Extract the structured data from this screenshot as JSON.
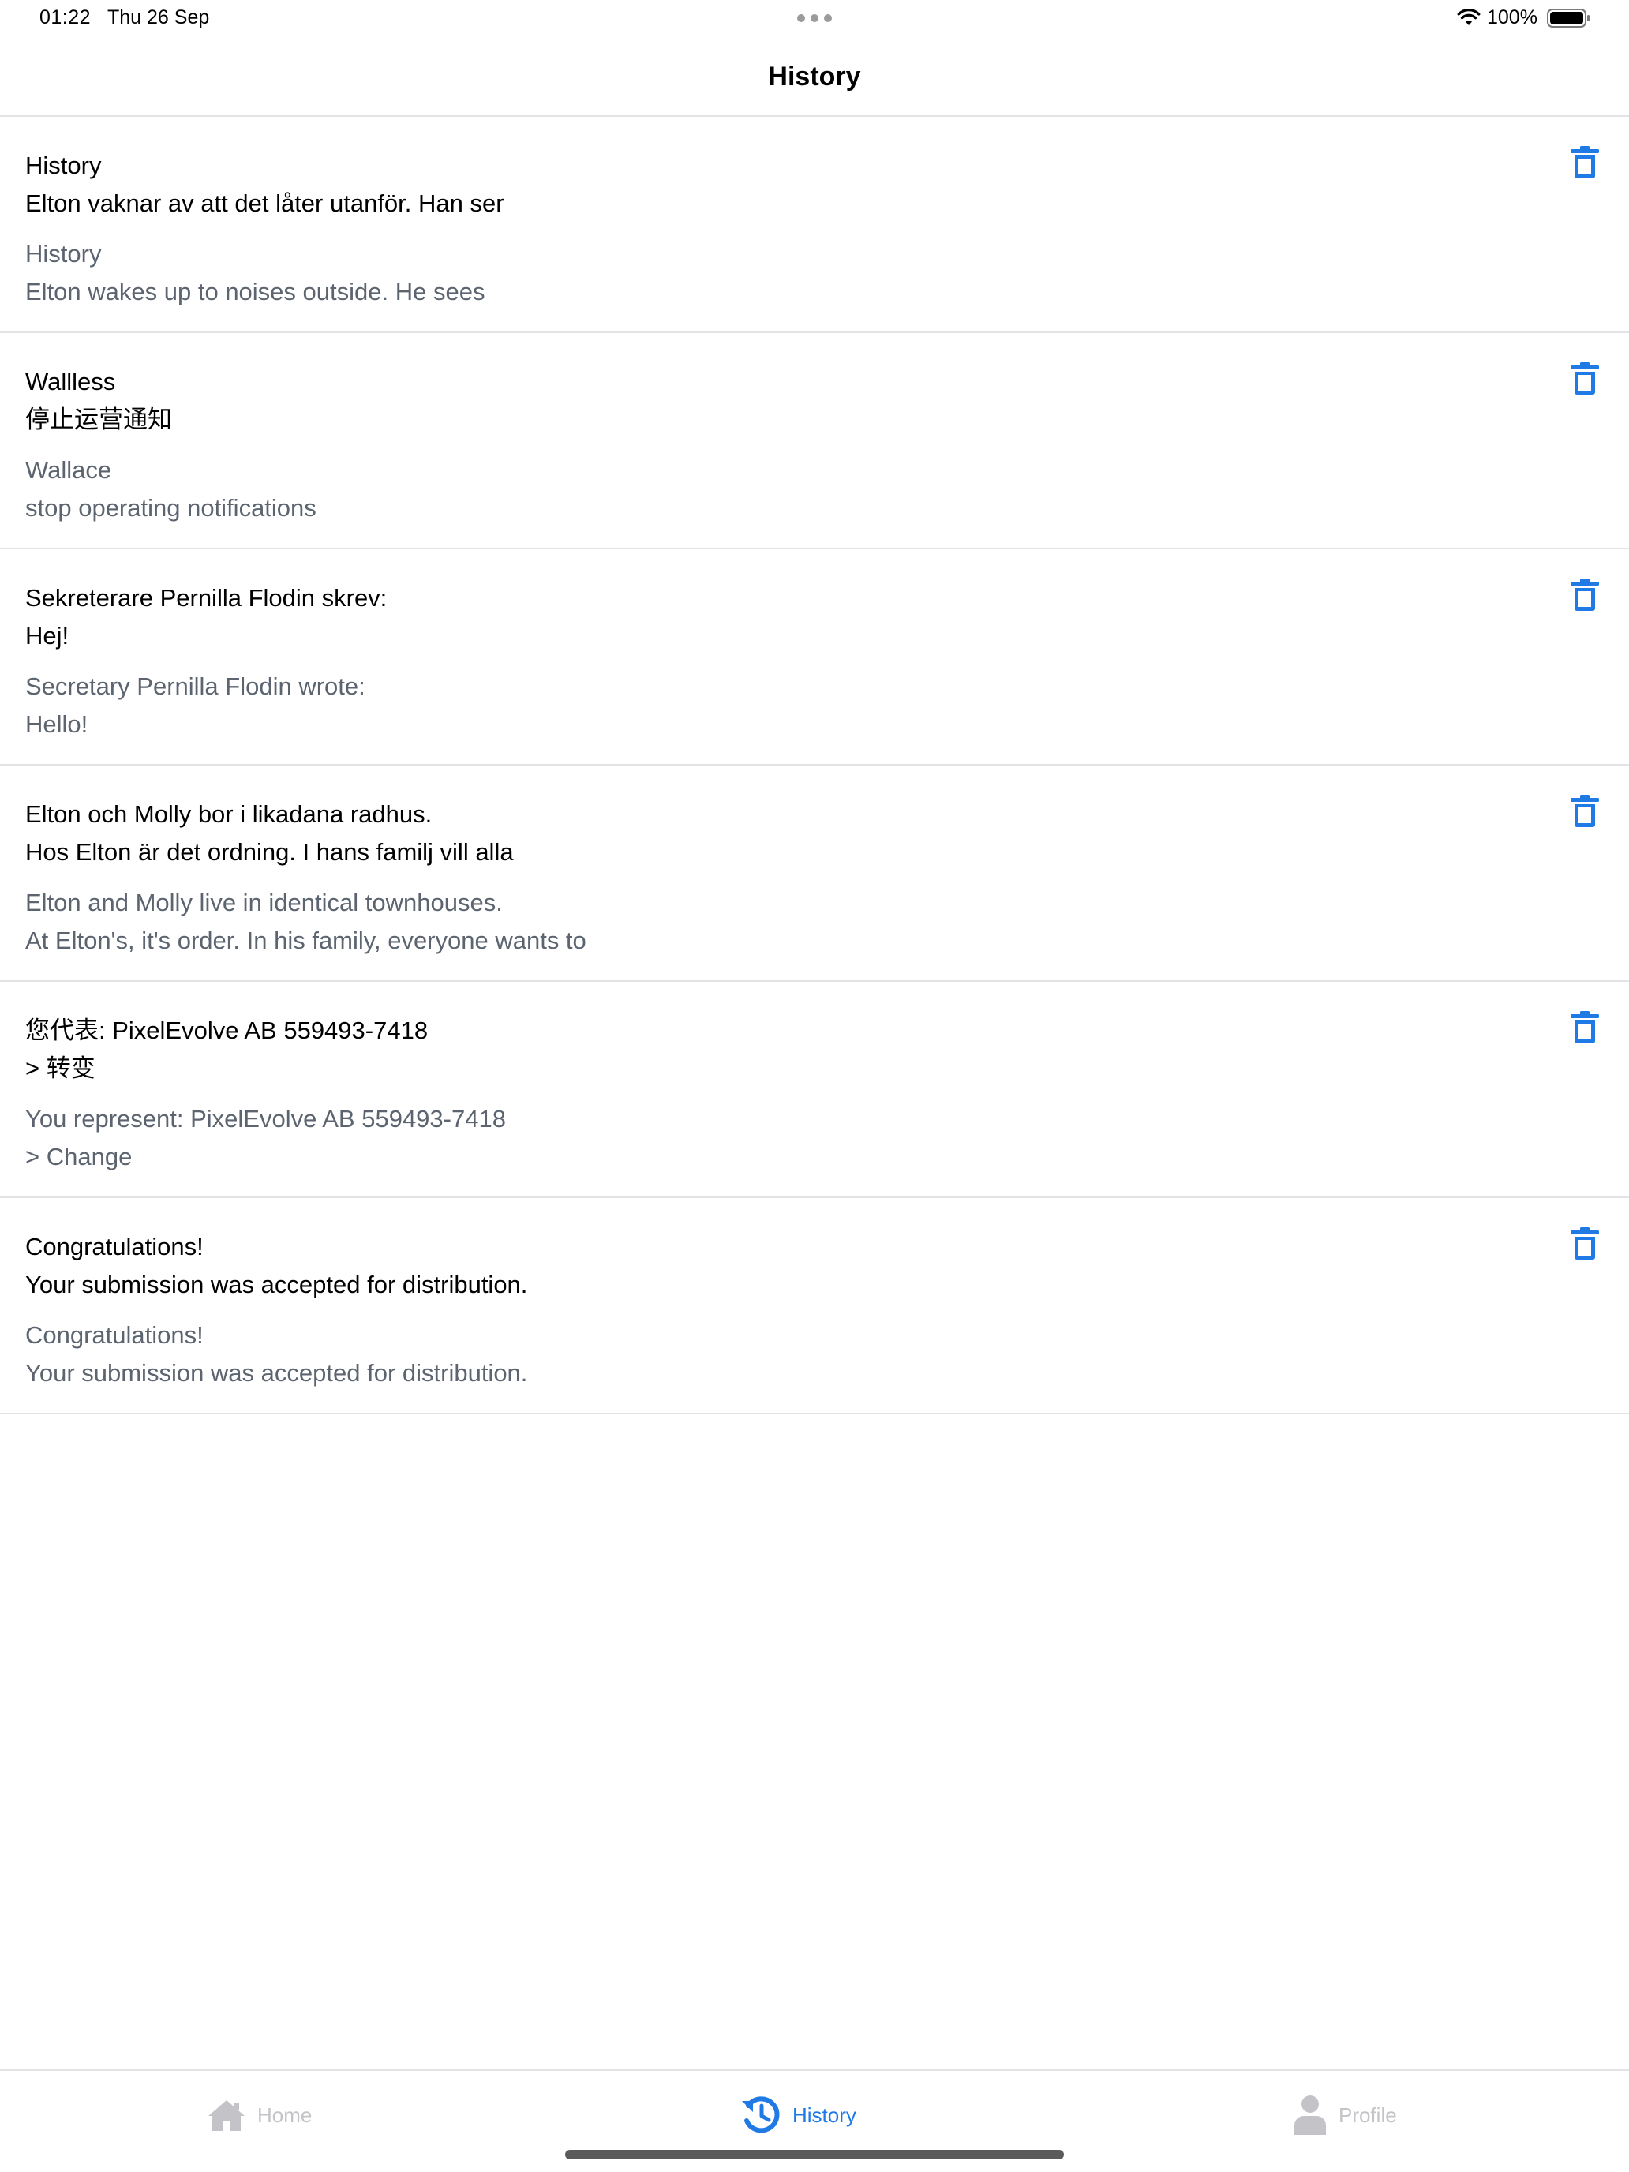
{
  "status_bar": {
    "time": "01:22",
    "date": "Thu 26 Sep",
    "battery": "100%"
  },
  "nav": {
    "title": "History"
  },
  "history": [
    {
      "original": "History\nElton vaknar av att det låter utanför. Han ser",
      "translation": "History\nElton wakes up to noises outside. He sees"
    },
    {
      "original": "Wallless\n停止运营通知",
      "translation": "Wallace\nstop operating notifications"
    },
    {
      "original": "Sekreterare Pernilla Flodin skrev:\nHej!",
      "translation": "Secretary Pernilla Flodin wrote:\nHello!"
    },
    {
      "original": "Elton och Molly bor i likadana radhus.\nHos Elton är det ordning. I hans familj vill alla",
      "translation": "Elton and Molly live in identical townhouses.\nAt Elton's, it's order. In his family, everyone wants to"
    },
    {
      "original": "您代表: PixelEvolve AB 559493-7418\n> 转变",
      "translation": "You represent: PixelEvolve AB 559493-7418\n> Change"
    },
    {
      "original": "Congratulations!\nYour submission was accepted for distribution.",
      "translation": "Congratulations!\nYour submission was accepted for distribution."
    }
  ],
  "tabs": {
    "home": "Home",
    "history": "History",
    "profile": "Profile"
  },
  "colors": {
    "accent": "#1f7ae6",
    "inactive": "#c4c4c8",
    "secondary_text": "#5c6470",
    "divider": "#e3e3e6"
  },
  "icons": {
    "delete": "trash-icon",
    "home_tab": "home-icon",
    "history_tab": "history-icon",
    "profile_tab": "person-icon"
  }
}
